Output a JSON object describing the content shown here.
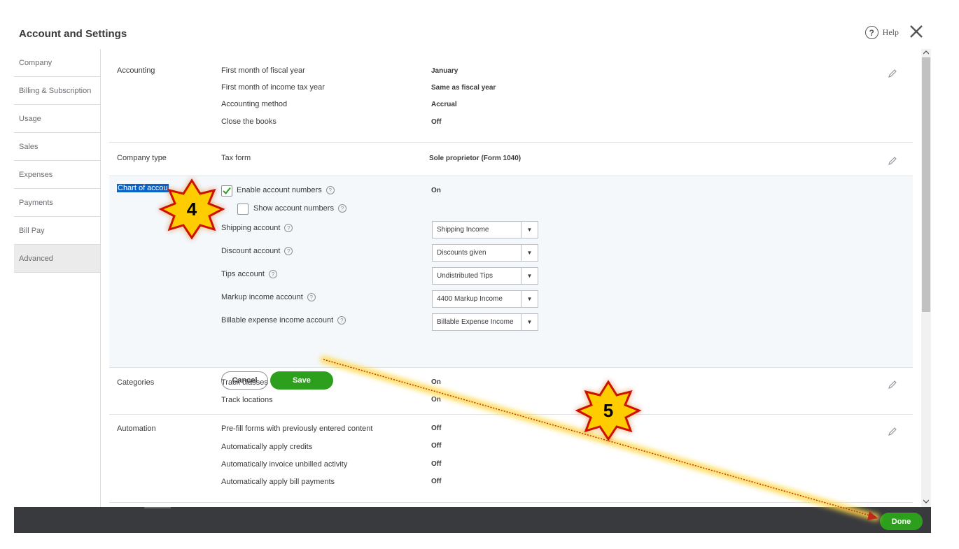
{
  "header": {
    "title": "Account and Settings",
    "help_label": "Help"
  },
  "sidebar": {
    "items": [
      {
        "label": "Company"
      },
      {
        "label": "Billing & Subscription"
      },
      {
        "label": "Usage"
      },
      {
        "label": "Sales"
      },
      {
        "label": "Expenses"
      },
      {
        "label": "Payments"
      },
      {
        "label": "Bill Pay"
      },
      {
        "label": "Advanced",
        "active": true
      }
    ]
  },
  "accounting": {
    "title": "Accounting",
    "rows": [
      {
        "label": "First month of fiscal year",
        "value": "January"
      },
      {
        "label": "First month of income tax year",
        "value": "Same as fiscal year"
      },
      {
        "label": "Accounting method",
        "value": "Accrual"
      },
      {
        "label": "Close the books",
        "value": "Off"
      }
    ]
  },
  "company_type": {
    "title": "Company type",
    "rows": [
      {
        "label": "Tax form",
        "value": "Sole proprietor (Form 1040)"
      }
    ]
  },
  "chart_of_accounts": {
    "title": "Chart of accou",
    "enable_account_numbers": {
      "label": "Enable account numbers",
      "checked": true,
      "value": "On"
    },
    "show_account_numbers": {
      "label": "Show account numbers",
      "checked": false
    },
    "dropdowns": [
      {
        "label": "Shipping account",
        "value": "Shipping Income"
      },
      {
        "label": "Discount account",
        "value": "Discounts given"
      },
      {
        "label": "Tips account",
        "value": "Undistributed Tips"
      },
      {
        "label": "Markup income account",
        "value": "4400 Markup Income"
      },
      {
        "label": "Billable expense income account",
        "value": "Billable Expense Income"
      }
    ],
    "cancel_label": "Cancel",
    "save_label": "Save"
  },
  "categories": {
    "title": "Categories",
    "rows": [
      {
        "label": "Track classes",
        "value": "On"
      },
      {
        "label": "Track locations",
        "value": "On"
      }
    ]
  },
  "automation": {
    "title": "Automation",
    "rows": [
      {
        "label": "Pre-fill forms with previously entered content",
        "value": "Off"
      },
      {
        "label": "Automatically apply credits",
        "value": "Off"
      },
      {
        "label": "Automatically invoice unbilled activity",
        "value": "Off"
      },
      {
        "label": "Automatically apply bill payments",
        "value": "Off"
      }
    ]
  },
  "footer": {
    "done_label": "Done"
  },
  "annotations": {
    "step_a": "4",
    "step_b": "5"
  },
  "colors": {
    "green": "#2ca01c",
    "footer": "#393a3d",
    "selection": "#0a64c8",
    "badge_fill": "#ffcc00",
    "badge_border": "#cc1100"
  }
}
